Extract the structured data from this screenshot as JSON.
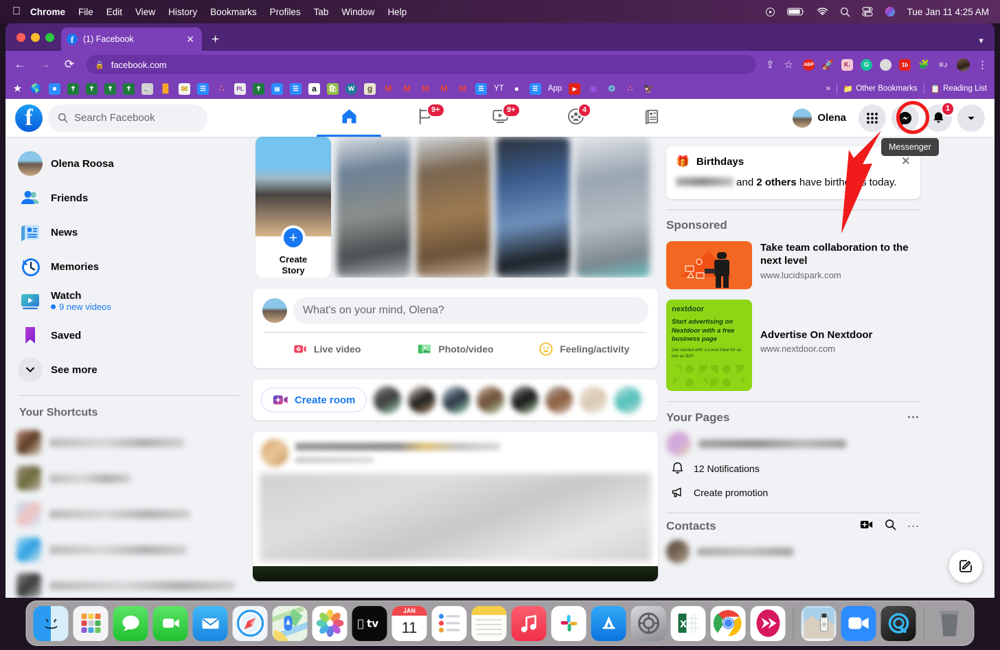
{
  "macos": {
    "apple_icon": "apple-icon",
    "menus": [
      "Chrome",
      "File",
      "Edit",
      "View",
      "History",
      "Bookmarks",
      "Profiles",
      "Tab",
      "Window",
      "Help"
    ],
    "status_icons": [
      "control-center-play-icon",
      "battery-icon",
      "wifi-icon",
      "search-icon",
      "control-center-icon",
      "siri-icon"
    ],
    "clock": "Tue Jan 11  4:25 AM"
  },
  "browser": {
    "tab": {
      "title": "(1) Facebook",
      "favicon": "facebook-favicon",
      "close_icon": "close-icon"
    },
    "new_tab_icon": "new-tab-icon",
    "window_chevron_icon": "chevron-down-icon",
    "back_icon": "back-arrow-icon",
    "forward_icon": "forward-arrow-icon",
    "reload_icon": "reload-icon",
    "url": "facebook.com",
    "lock_icon": "lock-icon",
    "share_icon": "share-icon",
    "bookmark_star_icon": "star-icon",
    "extensions": [
      {
        "name": "adblock-plus-extension",
        "label": "ABP",
        "color": "#e2231a"
      },
      {
        "name": "rocket-extension",
        "label": "🚀",
        "color": "transparent"
      },
      {
        "name": "k-extension",
        "label": "K.",
        "color": "#f4c7d4"
      },
      {
        "name": "grammarly-extension",
        "label": "G",
        "color": "#15c39a"
      },
      {
        "name": "gray-circle-extension",
        "label": "",
        "color": "#d8d8d8"
      },
      {
        "name": "onetab-extension",
        "label": "1b",
        "color": "#e2231a"
      },
      {
        "name": "puzzle-extensions-icon",
        "label": "🧩",
        "color": "transparent"
      },
      {
        "name": "reading-list-icon",
        "label": "≡♪",
        "color": "transparent"
      }
    ],
    "profile_avatar": "profile-avatar",
    "menu_icon": "three-dot-menu-icon",
    "bookmarks": [
      {
        "name": "star-bookmark",
        "label": "★",
        "color": "transparent"
      },
      {
        "name": "globe-bookmark",
        "label": "🌎",
        "color": "transparent"
      },
      {
        "name": "zoom-bookmark",
        "label": "■",
        "color": "#2d8cff"
      },
      {
        "name": "bible-bookmark-1",
        "label": "✝",
        "color": "#1e7a3c"
      },
      {
        "name": "bible-bookmark-2",
        "label": "✝",
        "color": "#1e7a3c"
      },
      {
        "name": "bible-bookmark-3",
        "label": "✝",
        "color": "#1e7a3c"
      },
      {
        "name": "bible-bookmark-4",
        "label": "✝",
        "color": "#1e7a3c"
      },
      {
        "name": "news-bookmark",
        "label": "📰",
        "color": "#b8b8b8"
      },
      {
        "name": "analytics-bookmark",
        "label": "▃",
        "color": "transparent"
      },
      {
        "name": "mail-bookmark",
        "label": "✉",
        "color": "#f1f1f1"
      },
      {
        "name": "docs-bookmark-1",
        "label": "☰",
        "color": "#2d8cff"
      },
      {
        "name": "asana-bookmark",
        "label": "∴",
        "color": "transparent"
      },
      {
        "name": "pl-bookmark",
        "label": "PL",
        "color": "#e6e6e6"
      },
      {
        "name": "bible-bookmark-5",
        "label": "✝",
        "color": "#1e7a3c"
      },
      {
        "name": "calendar-bookmark",
        "label": "▤",
        "color": "#2d8cff"
      },
      {
        "name": "docs-bookmark-2",
        "label": "☰",
        "color": "#2d8cff"
      },
      {
        "name": "amazon-bookmark",
        "label": "a",
        "color": "#ffffff"
      },
      {
        "name": "shopify-bookmark",
        "label": "🛍",
        "color": "#96bf48"
      },
      {
        "name": "wordpress-bookmark",
        "label": "W",
        "color": "#21759b"
      },
      {
        "name": "goodreads-bookmark",
        "label": "g",
        "color": "#e9e5d0"
      },
      {
        "name": "gmail-bookmark-1",
        "label": "M",
        "color": "transparent"
      },
      {
        "name": "gmail-bookmark-2",
        "label": "M",
        "color": "transparent"
      },
      {
        "name": "gmail-bookmark-3",
        "label": "M",
        "color": "transparent"
      },
      {
        "name": "gmail-bookmark-4",
        "label": "M",
        "color": "transparent"
      },
      {
        "name": "gmail-bookmark-5",
        "label": "M",
        "color": "transparent"
      },
      {
        "name": "docs-bookmark-3",
        "label": "☰",
        "color": "#2d8cff"
      }
    ],
    "bookmark_labels": [
      {
        "name": "youtube-bookmark",
        "label": "YT",
        "color": "transparent"
      },
      {
        "name": "dark-circle-bookmark",
        "label": "●",
        "color": "transparent"
      },
      {
        "name": "docs-bookmark-4",
        "label": "☰",
        "color": "#2d8cff"
      },
      {
        "name": "app-bookmark",
        "label": "App",
        "color": "#e2231a"
      },
      {
        "name": "youtube-bookmark-2",
        "label": "▶",
        "color": "#e2231a"
      },
      {
        "name": "c-bookmark",
        "label": "C",
        "color": "transparent"
      },
      {
        "name": "circle-bookmark",
        "label": "❂",
        "color": "transparent"
      },
      {
        "name": "asana-bookmark-2",
        "label": "∴",
        "color": "transparent"
      },
      {
        "name": "owl-bookmark",
        "label": "🦅",
        "color": "transparent"
      }
    ],
    "overflow_label": "»",
    "other_bookmarks": "Other Bookmarks",
    "other_bookmarks_icon": "folder-icon",
    "reading_list": "Reading List",
    "reading_list_icon": "reading-list-icon"
  },
  "facebook": {
    "logo_icon": "facebook-logo-icon",
    "search": {
      "placeholder": "Search Facebook",
      "icon": "search-icon"
    },
    "nav_tabs": [
      {
        "name": "tab-home",
        "icon": "home-icon",
        "badge": "",
        "active": true
      },
      {
        "name": "tab-pages",
        "icon": "flag-icon",
        "badge": "9+",
        "active": false
      },
      {
        "name": "tab-watch",
        "icon": "watch-icon",
        "badge": "9+",
        "active": false
      },
      {
        "name": "tab-groups",
        "icon": "groups-icon",
        "badge": "4",
        "active": false
      },
      {
        "name": "tab-news",
        "icon": "news-feed-icon",
        "badge": "",
        "active": false
      }
    ],
    "profile_name": "Olena",
    "header_buttons": [
      {
        "name": "menu-grid-button",
        "icon": "grid-icon",
        "badge": ""
      },
      {
        "name": "messenger-button",
        "icon": "messenger-icon",
        "badge": ""
      },
      {
        "name": "notifications-button",
        "icon": "bell-icon",
        "badge": "1"
      },
      {
        "name": "account-button",
        "icon": "chevron-down-icon",
        "badge": ""
      }
    ],
    "tooltip": "Messenger",
    "sidebar": [
      {
        "name": "sidebar-item-profile",
        "label": "Olena Roosa",
        "icon": "user-avatar",
        "sub": ""
      },
      {
        "name": "sidebar-item-friends",
        "label": "Friends",
        "icon": "friends-icon",
        "sub": ""
      },
      {
        "name": "sidebar-item-news",
        "label": "News",
        "icon": "news-icon",
        "sub": ""
      },
      {
        "name": "sidebar-item-memories",
        "label": "Memories",
        "icon": "memories-clock-icon",
        "sub": ""
      },
      {
        "name": "sidebar-item-watch",
        "label": "Watch",
        "icon": "watch-icon",
        "sub": "9 new videos"
      },
      {
        "name": "sidebar-item-saved",
        "label": "Saved",
        "icon": "saved-bookmark-icon",
        "sub": ""
      },
      {
        "name": "sidebar-item-see-more",
        "label": "See more",
        "icon": "chevron-down-icon",
        "sub": ""
      }
    ],
    "shortcuts_header": "Your Shortcuts",
    "shortcuts_count": 5,
    "stories": {
      "create_label": "Create\nStory",
      "create_line1": "Create",
      "create_line2": "Story",
      "plus_icon": "plus-icon",
      "blurred_count": 4
    },
    "composer": {
      "placeholder": "What's on your mind, Olena?",
      "actions": [
        {
          "name": "live-video-button",
          "label": "Live video",
          "icon": "live-video-icon"
        },
        {
          "name": "photo-video-button",
          "label": "Photo/video",
          "icon": "photo-icon"
        },
        {
          "name": "feeling-activity-button",
          "label": "Feeling/activity",
          "icon": "smiley-icon"
        }
      ]
    },
    "rooms": {
      "create_label": "Create room",
      "icon": "video-plus-icon",
      "avatar_count": 8
    },
    "right": {
      "birthdays": {
        "title": "Birthdays",
        "icon": "gift-icon",
        "close_icon": "close-icon",
        "text_mid": " and ",
        "bold": "2 others",
        "text_end": " have birthdays today."
      },
      "sponsored_header": "Sponsored",
      "ads": [
        {
          "name": "ad-lucidspark",
          "title": "Take team collaboration to the next level",
          "url": "www.lucidspark.com"
        },
        {
          "name": "ad-nextdoor",
          "title": "Advertise On Nextdoor",
          "url": "www.nextdoor.com",
          "brand": "nextdoor",
          "headline": "Start advertising on Nextdoor with a free business page",
          "sub": "Get started with a Local Deal for as low as $20"
        }
      ],
      "pages_header": "Your Pages",
      "pages_more_icon": "ellipsis-icon",
      "page_items": [
        {
          "name": "page-notifications",
          "label": "12 Notifications",
          "icon": "bell-icon"
        },
        {
          "name": "page-create-promotion",
          "label": "Create promotion",
          "icon": "megaphone-icon"
        }
      ],
      "contacts_header": "Contacts",
      "contacts_icons": [
        "video-room-icon",
        "search-icon",
        "ellipsis-icon"
      ],
      "new_message_icon": "compose-icon"
    }
  },
  "dock": [
    {
      "name": "dock-finder",
      "label": "Finder",
      "running": true
    },
    {
      "name": "dock-launchpad",
      "label": "Launchpad",
      "running": false
    },
    {
      "name": "dock-messages",
      "label": "Messages",
      "running": true
    },
    {
      "name": "dock-facetime",
      "label": "FaceTime",
      "running": false
    },
    {
      "name": "dock-mail",
      "label": "Mail",
      "running": true
    },
    {
      "name": "dock-safari",
      "label": "Safari",
      "running": false
    },
    {
      "name": "dock-maps",
      "label": "Maps",
      "running": false
    },
    {
      "name": "dock-photos",
      "label": "Photos",
      "running": false
    },
    {
      "name": "dock-appletv",
      "label": "Apple TV",
      "running": false
    },
    {
      "name": "dock-calendar",
      "label": "Calendar",
      "running": false,
      "month": "JAN",
      "day": "11"
    },
    {
      "name": "dock-reminders",
      "label": "Reminders",
      "running": false
    },
    {
      "name": "dock-notes",
      "label": "Notes",
      "running": true
    },
    {
      "name": "dock-music",
      "label": "Music",
      "running": false
    },
    {
      "name": "dock-slack",
      "label": "Slack",
      "running": false
    },
    {
      "name": "dock-appstore",
      "label": "App Store",
      "running": false
    },
    {
      "name": "dock-system-preferences",
      "label": "System Preferences",
      "running": false
    },
    {
      "name": "dock-excel",
      "label": "Excel",
      "running": true
    },
    {
      "name": "dock-chrome",
      "label": "Google Chrome",
      "running": true
    },
    {
      "name": "dock-sendit",
      "label": "Sendit",
      "running": false
    },
    {
      "name": "dock-preview",
      "label": "Preview",
      "running": false
    },
    {
      "name": "dock-zoom",
      "label": "Zoom",
      "running": false
    },
    {
      "name": "dock-quicktime",
      "label": "QuickTime",
      "running": false
    },
    {
      "name": "dock-trash",
      "label": "Trash",
      "running": false
    }
  ],
  "colors": {
    "fb_blue": "#1877f2",
    "badge_red": "#e41e3f",
    "annotation_red": "#f11b1b",
    "chrome_purple": "#7b3fb8"
  }
}
